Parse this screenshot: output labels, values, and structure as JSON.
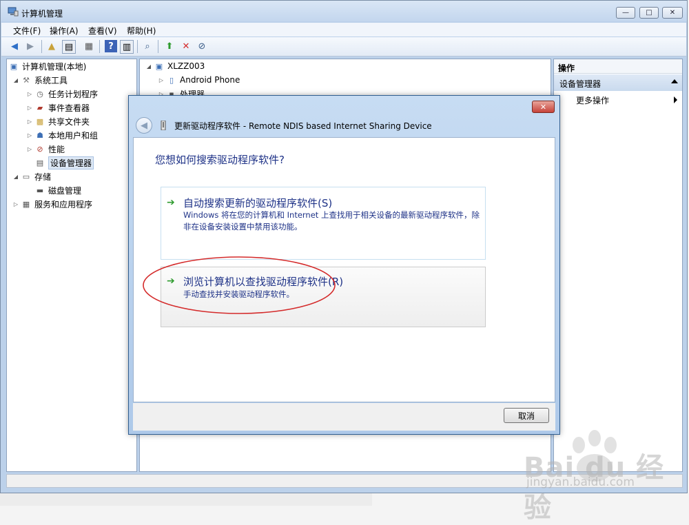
{
  "window": {
    "title": "计算机管理",
    "caption": {
      "minimize": "—",
      "maximize": "□",
      "close": "✕"
    }
  },
  "menu": [
    "文件(F)",
    "操作(A)",
    "查看(V)",
    "帮助(H)"
  ],
  "toolbar": {
    "icons": [
      "back-icon",
      "forward-icon",
      "up-folder-icon",
      "show-hide-tree-icon",
      "export-list-icon",
      "help-icon",
      "show-action-pane-icon",
      "scan-hardware-icon",
      "update-driver-icon",
      "uninstall-icon",
      "disable-device-icon"
    ]
  },
  "tree": {
    "items": [
      {
        "label": "计算机管理(本地)",
        "icon": "computer-management-icon"
      },
      {
        "label": "系统工具",
        "icon": "system-tools-icon"
      },
      {
        "label": "任务计划程序",
        "icon": "task-scheduler-icon"
      },
      {
        "label": "事件查看器",
        "icon": "event-viewer-icon"
      },
      {
        "label": "共享文件夹",
        "icon": "shared-folders-icon"
      },
      {
        "label": "本地用户和组",
        "icon": "users-groups-icon"
      },
      {
        "label": "性能",
        "icon": "performance-icon"
      },
      {
        "label": "设备管理器",
        "icon": "device-manager-icon"
      },
      {
        "label": "存储",
        "icon": "storage-icon"
      },
      {
        "label": "磁盘管理",
        "icon": "disk-management-icon"
      },
      {
        "label": "服务和应用程序",
        "icon": "services-apps-icon"
      }
    ]
  },
  "devices": {
    "root": "XLZZ003",
    "items": [
      "Android Phone",
      "处理器"
    ]
  },
  "actions": {
    "title": "操作",
    "section": "设备管理器",
    "more": "更多操作"
  },
  "dialog": {
    "title": "更新驱动程序软件 - Remote NDIS based Internet Sharing Device",
    "question": "您想如何搜索驱动程序软件?",
    "option_auto": {
      "title": "自动搜索更新的驱动程序软件(S)",
      "desc": "Windows 将在您的计算机和 Internet 上查找用于相关设备的最新驱动程序软件，除非在设备安装设置中禁用该功能。"
    },
    "option_browse": {
      "title": "浏览计算机以查找驱动程序软件(R)",
      "desc": "手动查找并安装驱动程序软件。"
    },
    "cancel": "取消",
    "close": "✕"
  },
  "watermark": {
    "text": "Bai du 经验",
    "url": "jingyan.baidu.com"
  },
  "colors": {
    "link_blue": "#1e3287",
    "arrow_green": "#2e9b2e",
    "annotation_red": "#d42a2a"
  }
}
